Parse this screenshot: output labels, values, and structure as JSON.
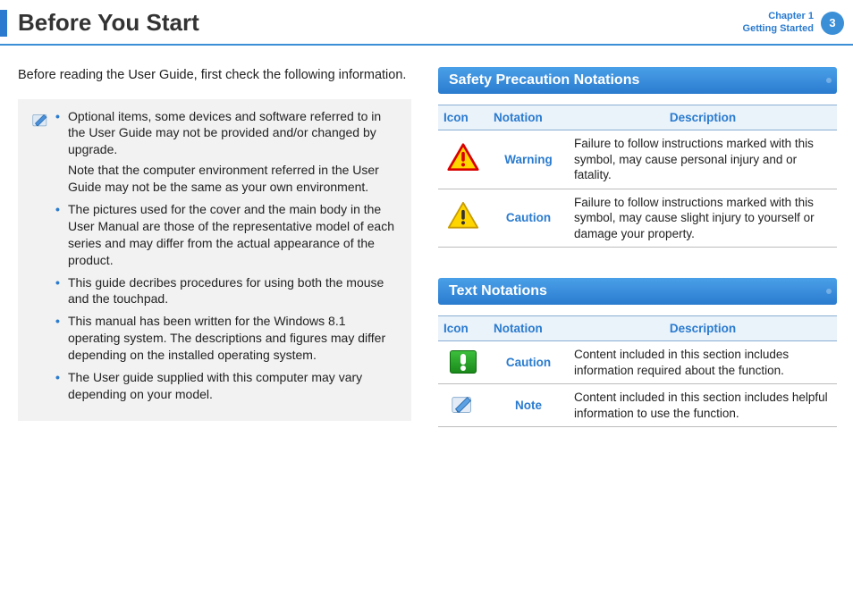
{
  "header": {
    "title": "Before You Start",
    "chapter_line1": "Chapter 1",
    "chapter_line2": "Getting Started",
    "page_number": "3"
  },
  "intro": "Before reading the User Guide, first check the following information.",
  "notes": {
    "items": [
      {
        "text": "Optional items, some devices and software referred to in the User Guide may not be provided and/or changed by upgrade.",
        "sub": "Note that the computer environment referred in the User Guide may not be the same as your own environment."
      },
      {
        "text": "The pictures used for the cover and the main body in the User Manual are those of the representative model of each series and may differ from the actual appearance of the product."
      },
      {
        "text": "This guide decribes procedures for using both the mouse and the touchpad."
      },
      {
        "text": "This manual has been written for the Windows 8.1 operating system. The descriptions and figures may differ depending on the installed operating system."
      },
      {
        "text": "The User guide supplied with this computer may vary depending on your model."
      }
    ]
  },
  "safety": {
    "title": "Safety Precaution Notations",
    "headers": {
      "icon": "Icon",
      "notation": "Notation",
      "description": "Description"
    },
    "rows": [
      {
        "icon": "warning-triangle-red",
        "notation": "Warning",
        "description": "Failure to follow instructions marked with this symbol, may cause personal injury and or fatality."
      },
      {
        "icon": "warning-triangle-yellow",
        "notation": "Caution",
        "description": "Failure to follow instructions marked with this symbol, may cause slight injury to yourself or damage your property."
      }
    ]
  },
  "text_notations": {
    "title": "Text Notations",
    "headers": {
      "icon": "Icon",
      "notation": "Notation",
      "description": "Description"
    },
    "rows": [
      {
        "icon": "caution-green-exclaim",
        "notation": "Caution",
        "description": "Content included in this section includes information required about the function."
      },
      {
        "icon": "note-pencil",
        "notation": "Note",
        "description": "Content included in this section includes helpful information to use the function."
      }
    ]
  }
}
